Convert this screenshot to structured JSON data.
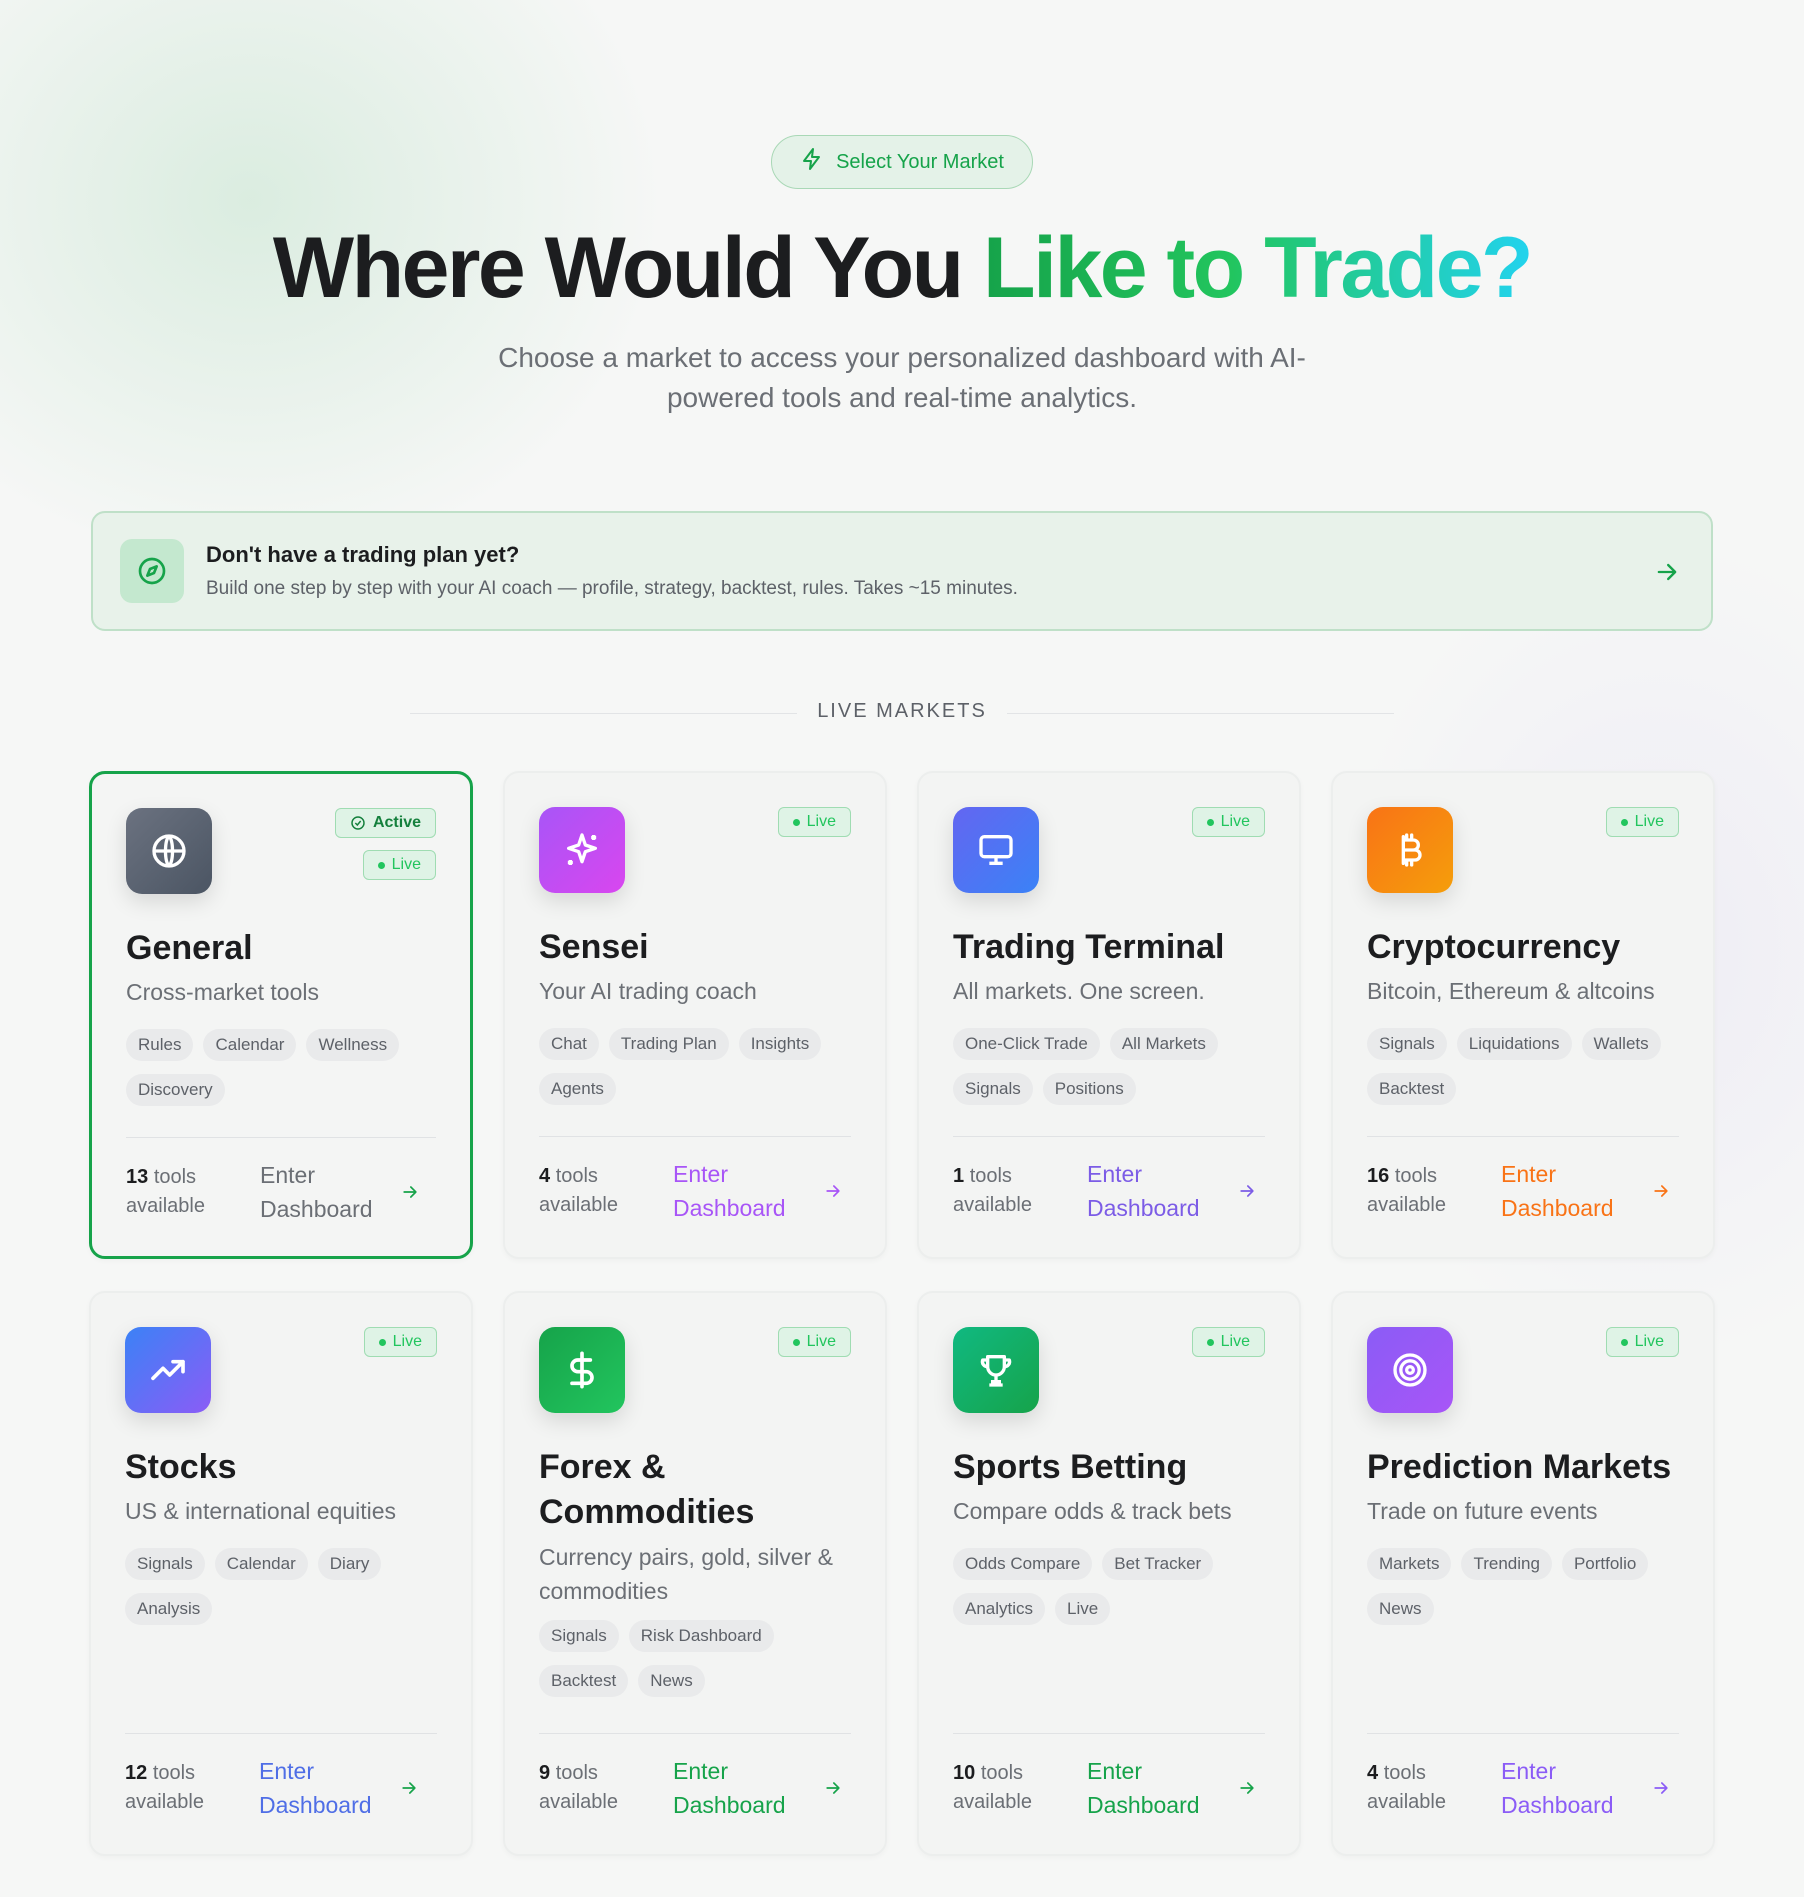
{
  "pill": {
    "label": "Select Your Market",
    "icon": "lightning-icon"
  },
  "hero": {
    "title_plain": "Where Would You ",
    "title_gradient": "Like to Trade?",
    "subtitle": "Choose a market to access your personalized dashboard with AI-powered tools and real-time analytics."
  },
  "plan_banner": {
    "icon": "compass-icon",
    "title": "Don't have a trading plan yet?",
    "description": "Build one step by step with your AI coach — profile, strategy, backtest, rules. Takes ~15 minutes."
  },
  "section": {
    "label": "LIVE MARKETS"
  },
  "cards": [
    {
      "title": "General",
      "subtitle": "Cross-market tools",
      "tags": [
        "Rules",
        "Calendar",
        "Wellness",
        "Discovery"
      ],
      "tool_count": "13",
      "tools_label": "tools available",
      "enter_label": "Enter Dashboard",
      "live_label": "Live",
      "active_label": "Active",
      "icon": "globe-icon",
      "accent": "#6b7280",
      "enter_color": "#6b6f75"
    },
    {
      "title": "Sensei",
      "subtitle": "Your AI trading coach",
      "tags": [
        "Chat",
        "Trading Plan",
        "Insights",
        "Agents"
      ],
      "tool_count": "4",
      "tools_label": "tools available",
      "enter_label": "Enter Dashboard",
      "live_label": "Live",
      "icon": "sparkles-icon",
      "accent": "#a855f7",
      "enter_color": "#a855f7"
    },
    {
      "title": "Trading Terminal",
      "subtitle": "All markets. One screen.",
      "tags": [
        "One-Click Trade",
        "All Markets",
        "Signals",
        "Positions"
      ],
      "tool_count": "1",
      "tools_label": "tools available",
      "enter_label": "Enter Dashboard",
      "live_label": "Live",
      "icon": "monitor-icon",
      "accent": "#6366f1",
      "enter_color": "#7c5ce6"
    },
    {
      "title": "Cryptocurrency",
      "subtitle": "Bitcoin, Ethereum & altcoins",
      "tags": [
        "Signals",
        "Liquidations",
        "Wallets",
        "Backtest"
      ],
      "tool_count": "16",
      "tools_label": "tools available",
      "enter_label": "Enter Dashboard",
      "live_label": "Live",
      "icon": "bitcoin-icon",
      "accent": "#f97316",
      "enter_color": "#f97316"
    },
    {
      "title": "Stocks",
      "subtitle": "US & international equities",
      "tags": [
        "Signals",
        "Calendar",
        "Diary",
        "Analysis"
      ],
      "tool_count": "12",
      "tools_label": "tools available",
      "enter_label": "Enter Dashboard",
      "live_label": "Live",
      "icon": "trending-up-icon",
      "accent": "#6366f1",
      "enter_color": "#4f6ee6"
    },
    {
      "title": "Forex & Commodities",
      "subtitle": "Currency pairs, gold, silver & commodities",
      "tags": [
        "Signals",
        "Risk Dashboard",
        "Backtest",
        "News"
      ],
      "tool_count": "9",
      "tools_label": "tools available",
      "enter_label": "Enter Dashboard",
      "live_label": "Live",
      "icon": "dollar-icon",
      "accent": "#16a34a",
      "enter_color": "#16a34a"
    },
    {
      "title": "Sports Betting",
      "subtitle": "Compare odds & track bets",
      "tags": [
        "Odds Compare",
        "Bet Tracker",
        "Analytics",
        "Live"
      ],
      "tool_count": "10",
      "tools_label": "tools available",
      "enter_label": "Enter Dashboard",
      "live_label": "Live",
      "icon": "trophy-icon",
      "accent": "#10b981",
      "enter_color": "#16a34a"
    },
    {
      "title": "Prediction Markets",
      "subtitle": "Trade on future events",
      "tags": [
        "Markets",
        "Trending",
        "Portfolio",
        "News"
      ],
      "tool_count": "4",
      "tools_label": "tools available",
      "enter_label": "Enter Dashboard",
      "live_label": "Live",
      "icon": "target-icon",
      "accent": "#8b5cf6",
      "enter_color": "#8b5cf6"
    }
  ]
}
